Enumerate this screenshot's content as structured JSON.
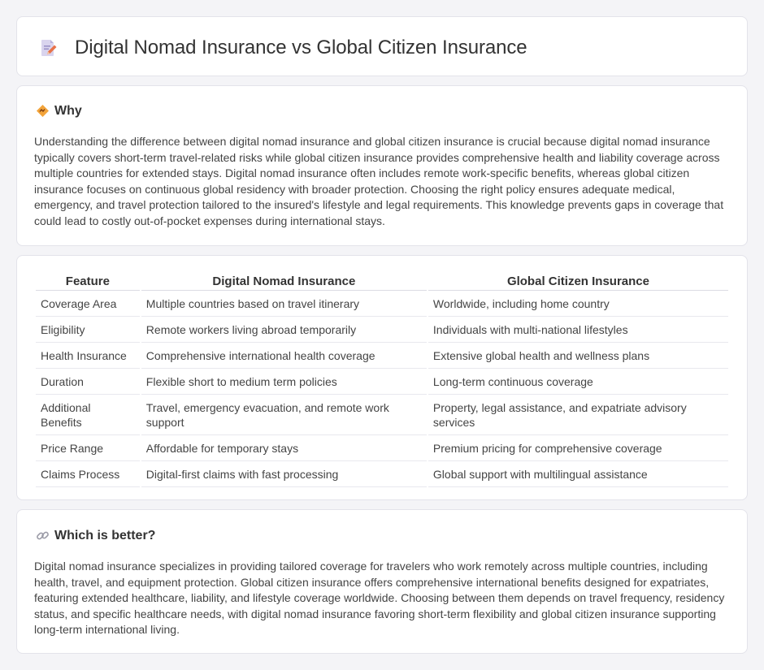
{
  "header": {
    "title": "Digital Nomad Insurance vs Global Citizen Insurance",
    "icon": "document-edit-icon"
  },
  "why": {
    "heading": "Why",
    "icon": "diamond-sign-icon",
    "body": "Understanding the difference between digital nomad insurance and global citizen insurance is crucial because digital nomad insurance typically covers short-term travel-related risks while global citizen insurance provides comprehensive health and liability coverage across multiple countries for extended stays. Digital nomad insurance often includes remote work-specific benefits, whereas global citizen insurance focuses on continuous global residency with broader protection. Choosing the right policy ensures adequate medical, emergency, and travel protection tailored to the insured's lifestyle and legal requirements. This knowledge prevents gaps in coverage that could lead to costly out-of-pocket expenses during international stays."
  },
  "table": {
    "headers": [
      "Feature",
      "Digital Nomad Insurance",
      "Global Citizen Insurance"
    ],
    "rows": [
      [
        "Coverage Area",
        "Multiple countries based on travel itinerary",
        "Worldwide, including home country"
      ],
      [
        "Eligibility",
        "Remote workers living abroad temporarily",
        "Individuals with multi-national lifestyles"
      ],
      [
        "Health Insurance",
        "Comprehensive international health coverage",
        "Extensive global health and wellness plans"
      ],
      [
        "Duration",
        "Flexible short to medium term policies",
        "Long-term continuous coverage"
      ],
      [
        "Additional Benefits",
        "Travel, emergency evacuation, and remote work support",
        "Property, legal assistance, and expatriate advisory services"
      ],
      [
        "Price Range",
        "Affordable for temporary stays",
        "Premium pricing for comprehensive coverage"
      ],
      [
        "Claims Process",
        "Digital-first claims with fast processing",
        "Global support with multilingual assistance"
      ]
    ]
  },
  "better": {
    "heading": "Which is better?",
    "icon": "link-icon",
    "body": "Digital nomad insurance specializes in providing tailored coverage for travelers who work remotely across multiple countries, including health, travel, and equipment protection. Global citizen insurance offers comprehensive international benefits designed for expatriates, featuring extended healthcare, liability, and lifestyle coverage worldwide. Choosing between them depends on travel frequency, residency status, and specific healthcare needs, with digital nomad insurance favoring short-term flexibility and global citizen insurance supporting long-term international living."
  },
  "colors": {
    "background": "#f4f4f7",
    "card": "#ffffff",
    "text": "#333333",
    "icon_accent": "#e8734a"
  }
}
